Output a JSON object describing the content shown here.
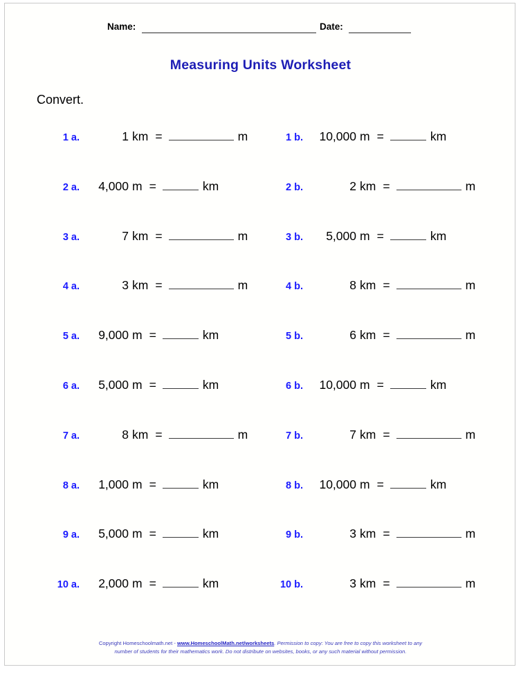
{
  "header": {
    "name_label": "Name:",
    "date_label": "Date:"
  },
  "title": "Measuring Units Worksheet",
  "instruction": "Convert.",
  "problems": [
    {
      "a": {
        "num": "1 a.",
        "value": "1",
        "unit": "km",
        "eq": "=",
        "answer_unit": "m",
        "blank": "long"
      },
      "b": {
        "num": "1 b.",
        "value": "10,000",
        "unit": "m",
        "eq": "=",
        "answer_unit": "km",
        "blank": "short"
      }
    },
    {
      "a": {
        "num": "2 a.",
        "value": "4,000",
        "unit": "m",
        "eq": "=",
        "answer_unit": "km",
        "blank": "short"
      },
      "b": {
        "num": "2 b.",
        "value": "2",
        "unit": "km",
        "eq": "=",
        "answer_unit": "m",
        "blank": "long"
      }
    },
    {
      "a": {
        "num": "3 a.",
        "value": "7",
        "unit": "km",
        "eq": "=",
        "answer_unit": "m",
        "blank": "long"
      },
      "b": {
        "num": "3 b.",
        "value": "5,000",
        "unit": "m",
        "eq": "=",
        "answer_unit": "km",
        "blank": "short"
      }
    },
    {
      "a": {
        "num": "4 a.",
        "value": "3",
        "unit": "km",
        "eq": "=",
        "answer_unit": "m",
        "blank": "long"
      },
      "b": {
        "num": "4 b.",
        "value": "8",
        "unit": "km",
        "eq": "=",
        "answer_unit": "m",
        "blank": "long"
      }
    },
    {
      "a": {
        "num": "5 a.",
        "value": "9,000",
        "unit": "m",
        "eq": "=",
        "answer_unit": "km",
        "blank": "short"
      },
      "b": {
        "num": "5 b.",
        "value": "6",
        "unit": "km",
        "eq": "=",
        "answer_unit": "m",
        "blank": "long"
      }
    },
    {
      "a": {
        "num": "6 a.",
        "value": "5,000",
        "unit": "m",
        "eq": "=",
        "answer_unit": "km",
        "blank": "short"
      },
      "b": {
        "num": "6 b.",
        "value": "10,000",
        "unit": "m",
        "eq": "=",
        "answer_unit": "km",
        "blank": "short"
      }
    },
    {
      "a": {
        "num": "7 a.",
        "value": "8",
        "unit": "km",
        "eq": "=",
        "answer_unit": "m",
        "blank": "long"
      },
      "b": {
        "num": "7 b.",
        "value": "7",
        "unit": "km",
        "eq": "=",
        "answer_unit": "m",
        "blank": "long"
      }
    },
    {
      "a": {
        "num": "8 a.",
        "value": "1,000",
        "unit": "m",
        "eq": "=",
        "answer_unit": "km",
        "blank": "short"
      },
      "b": {
        "num": "8 b.",
        "value": "10,000",
        "unit": "m",
        "eq": "=",
        "answer_unit": "km",
        "blank": "short"
      }
    },
    {
      "a": {
        "num": "9 a.",
        "value": "5,000",
        "unit": "m",
        "eq": "=",
        "answer_unit": "km",
        "blank": "short"
      },
      "b": {
        "num": "9 b.",
        "value": "3",
        "unit": "km",
        "eq": "=",
        "answer_unit": "m",
        "blank": "long"
      }
    },
    {
      "a": {
        "num": "10 a.",
        "value": "2,000",
        "unit": "m",
        "eq": "=",
        "answer_unit": "km",
        "blank": "short"
      },
      "b": {
        "num": "10 b.",
        "value": "3",
        "unit": "km",
        "eq": "=",
        "answer_unit": "m",
        "blank": "long"
      }
    }
  ],
  "footer": {
    "line1_prefix": "Copyright Homeschoolmath.net - ",
    "url": "www.HomeschoolMath.net/worksheets",
    "line1_suffix": ".  Permission to copy: You are free to copy this worksheet to any",
    "line2": "number of students for their mathematics work. Do not distribute on websites, books, or any such material without permission."
  },
  "colors": {
    "title_blue": "#1d1db5",
    "number_blue": "#1a1aff",
    "footer_blue": "#3b3bbb",
    "page_background": "#fffffd",
    "page_border": "#c9c9c9",
    "rule": "#3a3a3a"
  }
}
